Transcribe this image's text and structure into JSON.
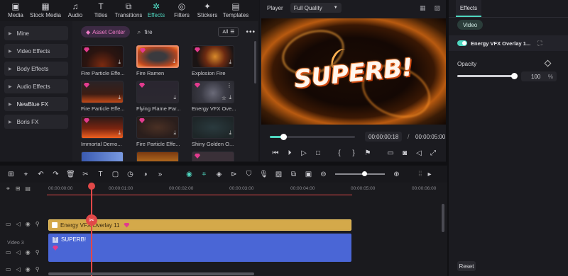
{
  "toolbar": {
    "items": [
      {
        "label": "Media",
        "icon": "media-icon"
      },
      {
        "label": "Stock Media",
        "icon": "stock-media-icon"
      },
      {
        "label": "Audio",
        "icon": "audio-icon"
      },
      {
        "label": "Titles",
        "icon": "titles-icon"
      },
      {
        "label": "Transitions",
        "icon": "transitions-icon"
      },
      {
        "label": "Effects",
        "icon": "effects-icon",
        "active": true
      },
      {
        "label": "Filters",
        "icon": "filters-icon"
      },
      {
        "label": "Stickers",
        "icon": "stickers-icon"
      },
      {
        "label": "Templates",
        "icon": "templates-icon"
      }
    ]
  },
  "categories": [
    "Mine",
    "Video Effects",
    "Body Effects",
    "Audio Effects",
    "NewBlue FX",
    "Boris FX"
  ],
  "effects_panel": {
    "asset_center_label": "Asset Center",
    "search_value": "fire",
    "filter_label": "All",
    "cards": [
      {
        "name": "Fire Particle Effe..."
      },
      {
        "name": "Fire Ramen"
      },
      {
        "name": "Explosion Fire"
      },
      {
        "name": "Fire Particle Effe..."
      },
      {
        "name": "Flying Flame Par..."
      },
      {
        "name": "Energy VFX Ove..."
      },
      {
        "name": "Immortal Demo..."
      },
      {
        "name": "Fire Particle Effe..."
      },
      {
        "name": "Shiny Golden O..."
      }
    ]
  },
  "player": {
    "label": "Player",
    "quality": "Full Quality",
    "overlay_text": "SUPERB!",
    "current_time": "00:00:00:18",
    "total_time": "00:00:05:00",
    "progress": 0.16
  },
  "properties": {
    "tab_label": "Effects",
    "video_button": "Video",
    "effect_name": "Energy VFX Overlay 1...",
    "opacity_label": "Opacity",
    "opacity_value": "100",
    "opacity_unit": "%",
    "opacity_level": 1.0,
    "reset_label": "Reset"
  },
  "timeline": {
    "ruler": [
      "00:00:00:00",
      "00:00:01:00",
      "00:00:02:00",
      "00:00:03:00",
      "00:00:04:00",
      "00:00:05:00",
      "00:00:06:00"
    ],
    "fx_clip_label": "Energy VFX Overlay 11",
    "title_clip_label": "SUPERB!",
    "track_label": "Video 3"
  },
  "colors": {
    "accent": "#4fd7c0",
    "playhead": "#e24848",
    "fx_clip": "#d4a94a",
    "title_clip": "#4a66d6",
    "premium_gem": "#e23b8e"
  }
}
